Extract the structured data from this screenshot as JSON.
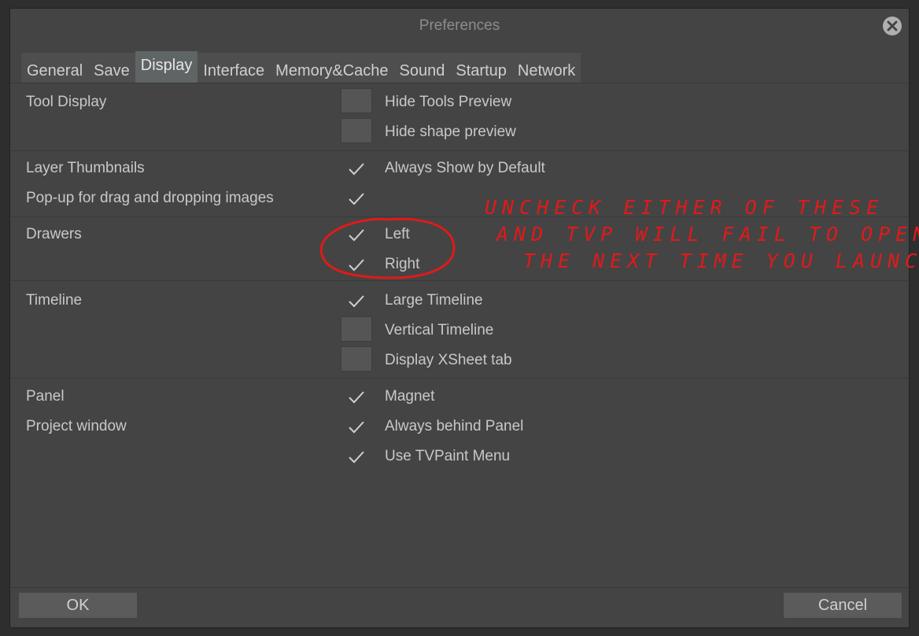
{
  "window": {
    "title": "Preferences"
  },
  "tabs": [
    {
      "label": "General"
    },
    {
      "label": "Save"
    },
    {
      "label": "Display"
    },
    {
      "label": "Interface"
    },
    {
      "label": "Memory&Cache"
    },
    {
      "label": "Sound"
    },
    {
      "label": "Startup"
    },
    {
      "label": "Network"
    }
  ],
  "active_tab": "Display",
  "sections": {
    "tool_display": {
      "label": "Tool Display",
      "options": [
        {
          "label": "Hide Tools Preview",
          "checked": false
        },
        {
          "label": "Hide shape preview",
          "checked": false
        }
      ]
    },
    "layer": {
      "label1": "Layer Thumbnails",
      "label2": "Pop-up for drag and dropping images",
      "options": [
        {
          "label": "Always Show by Default",
          "checked": true
        },
        {
          "label": "",
          "checked": true
        }
      ]
    },
    "drawers": {
      "label": "Drawers",
      "options": [
        {
          "label": "Left",
          "checked": true
        },
        {
          "label": "Right",
          "checked": true
        }
      ]
    },
    "timeline": {
      "label": "Timeline",
      "options": [
        {
          "label": "Large Timeline",
          "checked": true
        },
        {
          "label": "Vertical Timeline",
          "checked": false
        },
        {
          "label": "Display XSheet tab",
          "checked": false
        }
      ]
    },
    "panel": {
      "label1": "Panel",
      "label2": "Project window",
      "options": [
        {
          "label": "Magnet",
          "checked": true
        },
        {
          "label": "Always behind Panel",
          "checked": true
        },
        {
          "label": "Use TVPaint Menu",
          "checked": true
        }
      ]
    }
  },
  "annotation": {
    "line1": "UNCHECK EITHER OF THESE",
    "line2": "AND TVP WILL FAIL TO OPEN",
    "line3": "THE NEXT TIME YOU LAUNCH."
  },
  "footer": {
    "ok_label": "OK",
    "cancel_label": "Cancel"
  },
  "colors": {
    "annotation": "#e01a1a",
    "active_tab": "#5f6464",
    "background": "#444444"
  }
}
